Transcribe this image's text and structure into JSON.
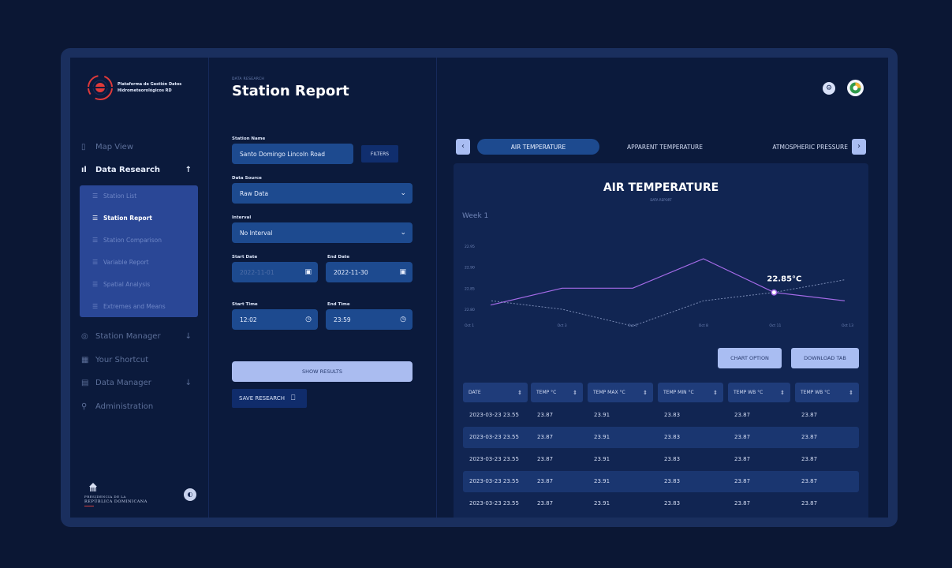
{
  "brand": {
    "line1": "Plataforma de Gestión Datos",
    "line2": "Hidrometeorológicos RD"
  },
  "nav": {
    "map_view": "Map View",
    "data_research": "Data Research",
    "station_manager": "Station Manager",
    "your_shortcut": "Your Shortcut",
    "data_manager": "Data Manager",
    "administration": "Administration"
  },
  "submenu": [
    "Station List",
    "Station Report",
    "Station Comparison",
    "Variable Report",
    "Spatial Analysis",
    "Extremes and Means"
  ],
  "gov": {
    "line1": "PRESIDENCIA DE LA",
    "line2": "REPÚBLICA DOMINICANA"
  },
  "page": {
    "breadcrumb": "DATA RESEARCH",
    "title": "Station Report"
  },
  "form": {
    "station_name_label": "Station Name",
    "station_name_value": "Santo Domingo Lincoln Road",
    "filters_label": "FILTERS",
    "data_source_label": "Data Source",
    "data_source_value": "Raw Data",
    "interval_label": "Interval",
    "interval_value": "No Interval",
    "start_date_label": "Start Date",
    "start_date_value": "2022-11-01",
    "end_date_label": "End Date",
    "end_date_value": "2022-11-30",
    "start_time_label": "Start Time",
    "start_time_value": "12:02",
    "end_time_label": "End Time",
    "end_time_value": "23:59",
    "show_results_label": "SHOW RESULTS",
    "save_research_label": "SAVE RESEARCH"
  },
  "tabs": [
    "AIR TEMPERATURE",
    "APPARENT TEMPERATURE",
    "ATMOSPHERIC PRESSURE"
  ],
  "chart_data": {
    "type": "line",
    "title": "AIR TEMPERATURE",
    "subtitle": "DATA REPORT",
    "period": "Week 1",
    "x": [
      "Oct 1",
      "Oct 3",
      "Oct 5",
      "Oct 8",
      "Oct 11",
      "Oct 13"
    ],
    "yticks": [
      "22.95",
      "22.90",
      "22.85",
      "22.80"
    ],
    "ylim": [
      22.8,
      22.95
    ],
    "series": [
      {
        "style": "solid",
        "color": "#a56be8",
        "values": [
          22.81,
          22.85,
          22.85,
          22.92,
          22.84,
          22.82
        ]
      },
      {
        "style": "dashed",
        "color": "#7a8bb5",
        "values": [
          22.82,
          22.8,
          22.76,
          22.82,
          22.84,
          22.87
        ]
      }
    ],
    "highlight": {
      "index": 4,
      "label": "22.85°C"
    },
    "grid": false,
    "legend": "none"
  },
  "table": {
    "chart_option_label": "CHART OPTION",
    "download_label": "DOWNLOAD TAB",
    "headers": [
      "DATE",
      "TEMP °C",
      "TEMP MAX °C",
      "TEMP MIN °C",
      "TEMP WB °C",
      "TEMP WB °C"
    ],
    "rows": [
      [
        "2023-03-23 23.55",
        "23.87",
        "23.91",
        "23.83",
        "23.87",
        "23.87"
      ],
      [
        "2023-03-23 23.55",
        "23.87",
        "23.91",
        "23.83",
        "23.87",
        "23.87"
      ],
      [
        "2023-03-23 23.55",
        "23.87",
        "23.91",
        "23.83",
        "23.87",
        "23.87"
      ],
      [
        "2023-03-23 23.55",
        "23.87",
        "23.91",
        "23.83",
        "23.87",
        "23.87"
      ],
      [
        "2023-03-23 23.55",
        "23.87",
        "23.91",
        "23.83",
        "23.87",
        "23.87"
      ]
    ]
  },
  "colors": {
    "accent": "#1d4a8f",
    "highlight_line": "#a56be8",
    "bg": "#0b1a3c"
  }
}
